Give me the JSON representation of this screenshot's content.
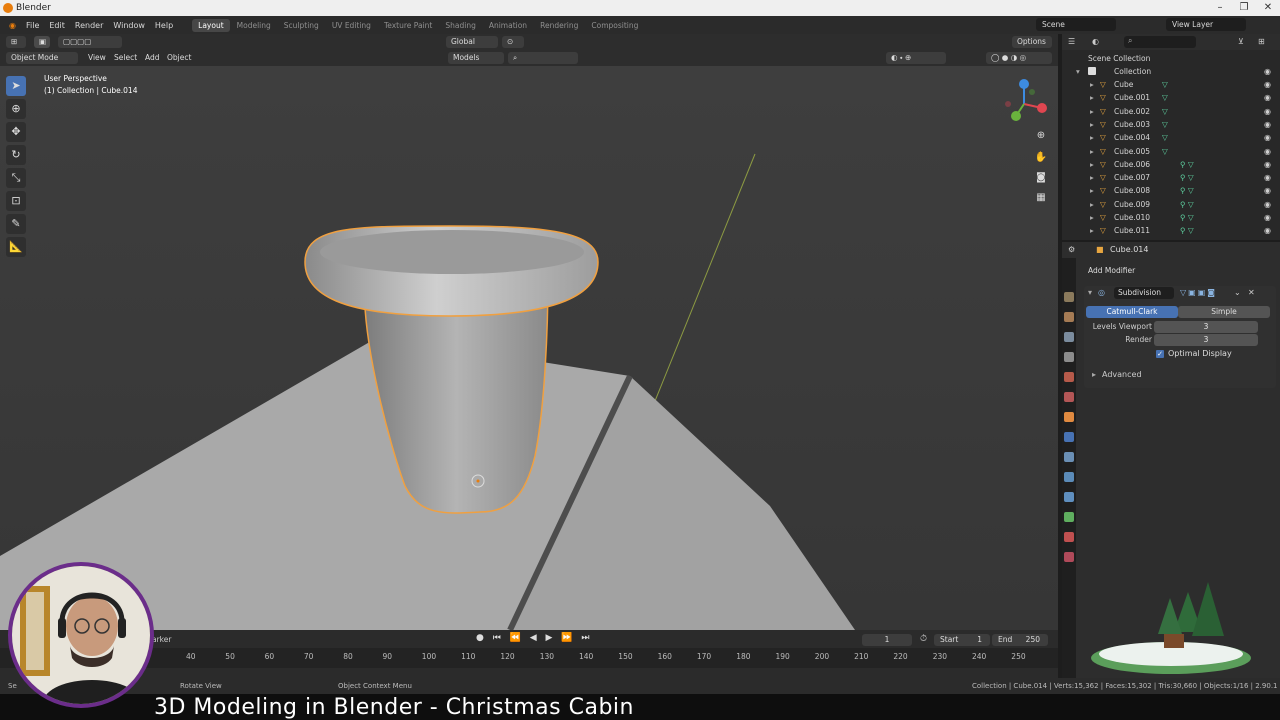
{
  "window": {
    "title": "Blender"
  },
  "menu": [
    "File",
    "Edit",
    "Render",
    "Window",
    "Help"
  ],
  "workspaces": [
    {
      "label": "Layout",
      "active": true
    },
    {
      "label": "Modeling",
      "active": false
    },
    {
      "label": "Sculpting",
      "active": false
    },
    {
      "label": "UV Editing",
      "active": false
    },
    {
      "label": "Texture Paint",
      "active": false
    },
    {
      "label": "Shading",
      "active": false
    },
    {
      "label": "Animation",
      "active": false
    },
    {
      "label": "Rendering",
      "active": false
    },
    {
      "label": "Compositing",
      "active": false
    }
  ],
  "scene": {
    "name": "Scene",
    "view_layer": "View Layer"
  },
  "tool_header": {
    "orientation": "Global",
    "options": "Options"
  },
  "viewport_header": {
    "mode": "Object Mode",
    "menus": [
      "View",
      "Select",
      "Add",
      "Object"
    ],
    "collection_filter": "Models"
  },
  "viewport": {
    "perspective": "User Perspective",
    "active_object": "(1) Collection | Cube.014"
  },
  "outliner": {
    "root": "Scene Collection",
    "collection": "Collection",
    "objects": [
      "Cube",
      "Cube.001",
      "Cube.002",
      "Cube.003",
      "Cube.004",
      "Cube.005",
      "Cube.006",
      "Cube.007",
      "Cube.008",
      "Cube.009",
      "Cube.010",
      "Cube.011"
    ]
  },
  "properties": {
    "object_name": "Cube.014",
    "add_modifier": "Add Modifier",
    "modifier": {
      "name": "Subdivision",
      "type_a": "Catmull-Clark",
      "type_b": "Simple",
      "levels_label": "Levels Viewport",
      "levels_value": "3",
      "render_label": "Render",
      "render_value": "3",
      "optimal_display": "Optimal Display",
      "advanced": "Advanced"
    }
  },
  "timeline": {
    "marker_label": "arker",
    "current_frame": "1",
    "start_label": "Start",
    "start_value": "1",
    "end_label": "End",
    "end_value": "250",
    "ticks": [
      "40",
      "50",
      "60",
      "70",
      "80",
      "90",
      "100",
      "110",
      "120",
      "130",
      "140",
      "150",
      "160",
      "170",
      "180",
      "190",
      "200",
      "210",
      "220",
      "230",
      "240",
      "250"
    ]
  },
  "statusbar": {
    "left": "Se",
    "rotate": "Rotate View",
    "context": "Object Context Menu",
    "stats": "Collection | Cube.014 | Verts:15,362 | Faces:15,302 | Tris:30,660 | Objects:1/16 | 2.90.1"
  },
  "caption": "3D Modeling in Blender - Christmas Cabin",
  "colors": {
    "accent": "#4772b3",
    "selection": "#f0a040",
    "title_bar": "#efefef"
  }
}
